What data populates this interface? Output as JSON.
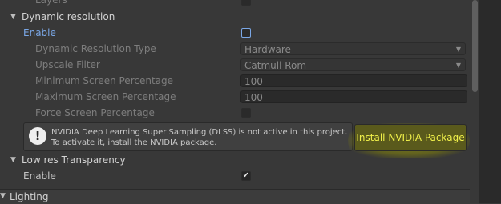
{
  "top_partial": {
    "label": "Layers"
  },
  "dynamic_resolution": {
    "title": "Dynamic resolution",
    "enable_label": "Enable",
    "type_label": "Dynamic Resolution Type",
    "type_value": "Hardware",
    "upscale_label": "Upscale Filter",
    "upscale_value": "Catmull Rom",
    "min_label": "Minimum Screen Percentage",
    "min_value": "100",
    "max_label": "Maximum Screen Percentage",
    "max_value": "100",
    "force_label": "Force Screen Percentage"
  },
  "dlss_help": {
    "icon": "warning-icon",
    "text": "NVIDIA Deep Learning Super Sampling (DLSS) is not active in this project. To activate it, install the NVIDIA package.",
    "button_label": "Install NVIDIA Package"
  },
  "low_res_transparency": {
    "title": "Low res Transparency",
    "enable_label": "Enable",
    "enabled": true
  },
  "lighting": {
    "title": "Lighting"
  },
  "colors": {
    "accent": "#7aa7e6",
    "highlight": "#f0f04a"
  }
}
